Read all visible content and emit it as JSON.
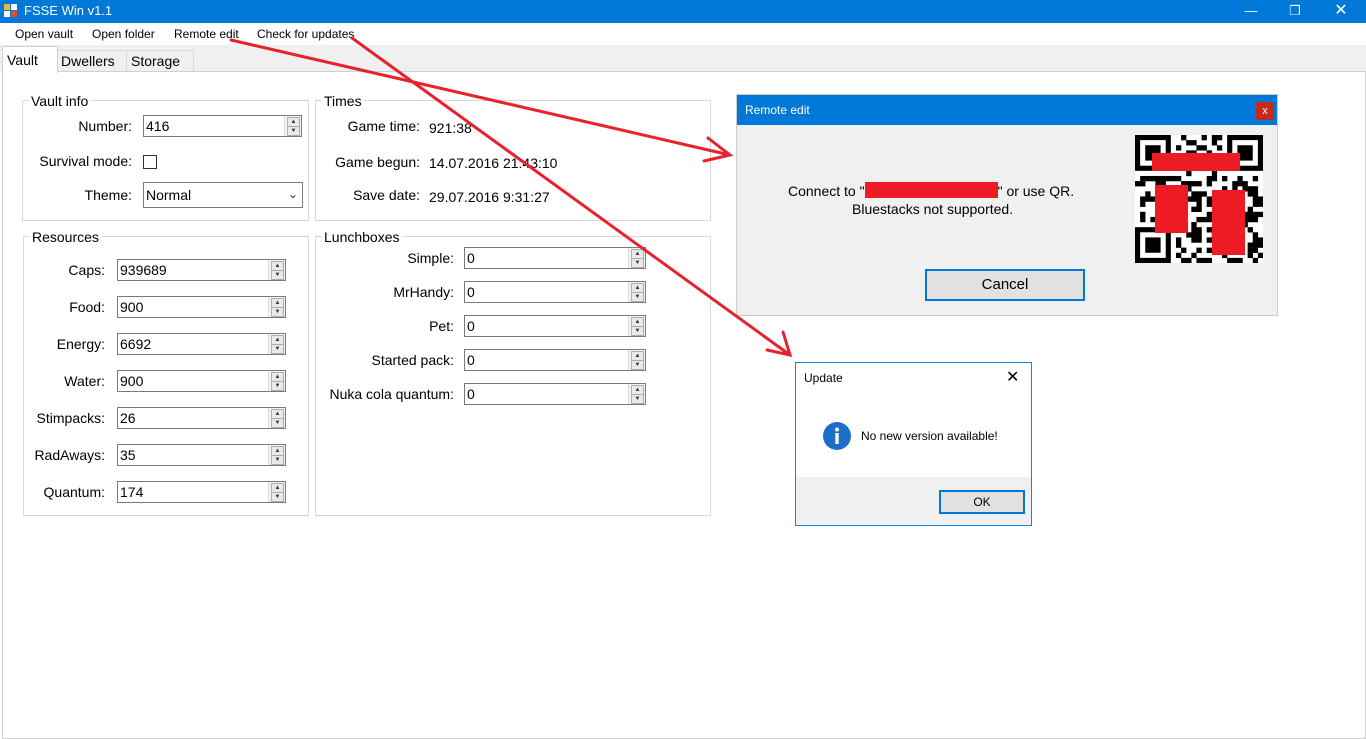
{
  "window": {
    "title": "FSSE Win v1.1"
  },
  "menu": [
    "Open vault",
    "Open folder",
    "Remote edit",
    "Check for updates"
  ],
  "tabs": [
    "Vault",
    "Dwellers",
    "Storage"
  ],
  "vault_info": {
    "title": "Vault info",
    "number_label": "Number:",
    "number_value": "416",
    "survival_label": "Survival mode:",
    "theme_label": "Theme:",
    "theme_value": "Normal"
  },
  "times": {
    "title": "Times",
    "game_time_label": "Game time:",
    "game_time_value": "921:38",
    "game_begun_label": "Game begun:",
    "game_begun_value": "14.07.2016 21:43:10",
    "save_date_label": "Save date:",
    "save_date_value": "29.07.2016 9:31:27"
  },
  "resources": {
    "title": "Resources",
    "items": [
      {
        "label": "Caps:",
        "value": "939689"
      },
      {
        "label": "Food:",
        "value": "900"
      },
      {
        "label": "Energy:",
        "value": "6692"
      },
      {
        "label": "Water:",
        "value": "900"
      },
      {
        "label": "Stimpacks:",
        "value": "26"
      },
      {
        "label": "RadAways:",
        "value": "35"
      },
      {
        "label": "Quantum:",
        "value": "174"
      }
    ]
  },
  "lunchboxes": {
    "title": "Lunchboxes",
    "items": [
      {
        "label": "Simple:",
        "value": "0"
      },
      {
        "label": "MrHandy:",
        "value": "0"
      },
      {
        "label": "Pet:",
        "value": "0"
      },
      {
        "label": "Started pack:",
        "value": "0"
      },
      {
        "label": "Nuka cola quantum:",
        "value": "0"
      }
    ]
  },
  "remote_dialog": {
    "title": "Remote edit",
    "close": "x",
    "connect_prefix": "Connect to \"",
    "connect_suffix": "\" or use QR.",
    "note": "Bluestacks not supported.",
    "cancel": "Cancel"
  },
  "update_dialog": {
    "title": "Update",
    "message": "No new version available!",
    "ok": "OK"
  },
  "colors": {
    "titlebar": "#0078d7",
    "annotation": "#e8222c",
    "redaction": "#ed1c24"
  }
}
